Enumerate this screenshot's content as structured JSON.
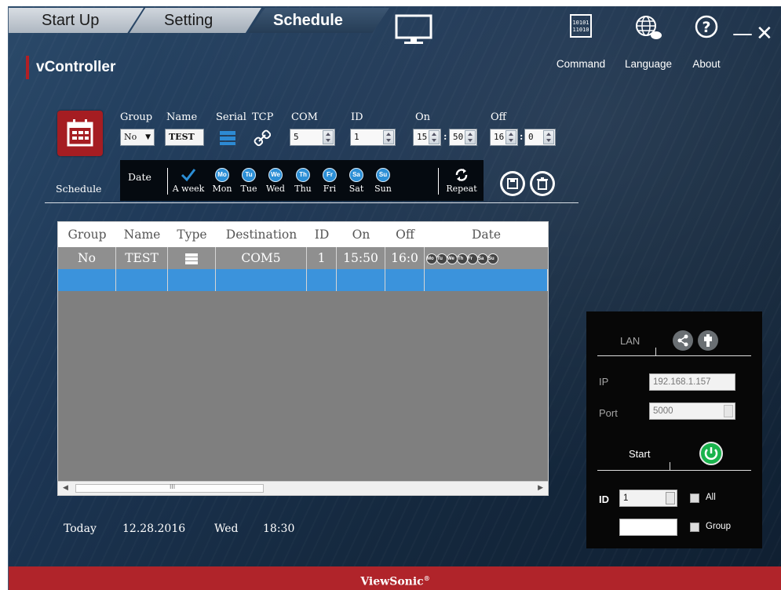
{
  "tabs": [
    {
      "label": "Start Up"
    },
    {
      "label": "Setting"
    },
    {
      "label": "Schedule"
    }
  ],
  "app_title": "vController",
  "top_right": {
    "command_label": "Command",
    "language_label": "Language",
    "about_label": "About",
    "command_icon_text_1": "10101",
    "command_icon_text_2": "11010"
  },
  "form": {
    "schedule_label": "Schedule",
    "headers": {
      "group": "Group",
      "name": "Name",
      "serial": "Serial",
      "tcp": "TCP",
      "com": "COM",
      "id": "ID",
      "on": "On",
      "off": "Off"
    },
    "group_value": "No",
    "name_value": "TEST",
    "com_value": "5",
    "id_value": "1",
    "on_hour": "15",
    "on_min": "50",
    "off_hour": "16",
    "off_min": "0",
    "colon": ":"
  },
  "days": {
    "date_label": "Date",
    "aweek_label": "A week",
    "repeat_label": "Repeat",
    "items": [
      {
        "abbr": "Mo",
        "label": "Mon"
      },
      {
        "abbr": "Tu",
        "label": "Tue"
      },
      {
        "abbr": "We",
        "label": "Wed"
      },
      {
        "abbr": "Th",
        "label": "Thu"
      },
      {
        "abbr": "Fr",
        "label": "Fri"
      },
      {
        "abbr": "Sa",
        "label": "Sat"
      },
      {
        "abbr": "Su",
        "label": "Sun"
      }
    ]
  },
  "table": {
    "columns": [
      "Group",
      "Name",
      "Type",
      "Destination",
      "ID",
      "On",
      "Off",
      "Date"
    ],
    "rows": [
      {
        "group": "No",
        "name": "TEST",
        "destination": "COM5",
        "id": "1",
        "on": "15:50",
        "off": "16:0"
      }
    ],
    "scroll_grip": "III"
  },
  "status": {
    "today_label": "Today",
    "date": "12.28.2016",
    "weekday": "Wed",
    "time": "18:30"
  },
  "lan": {
    "title": "LAN",
    "ip_label": "IP",
    "ip_value": "192.168.1.157",
    "port_label": "Port",
    "port_value": "5000",
    "start_label": "Start",
    "id_label": "ID",
    "id_value": "1",
    "all_label": "All",
    "group_label": "Group"
  },
  "footer": {
    "brand": "ViewSonic",
    "brand_mark": "®"
  },
  "colors": {
    "accent_red": "#b0242a",
    "day_blue": "#2c8fd6",
    "power_green": "#19b34c",
    "selection_blue": "#3b93dc"
  }
}
